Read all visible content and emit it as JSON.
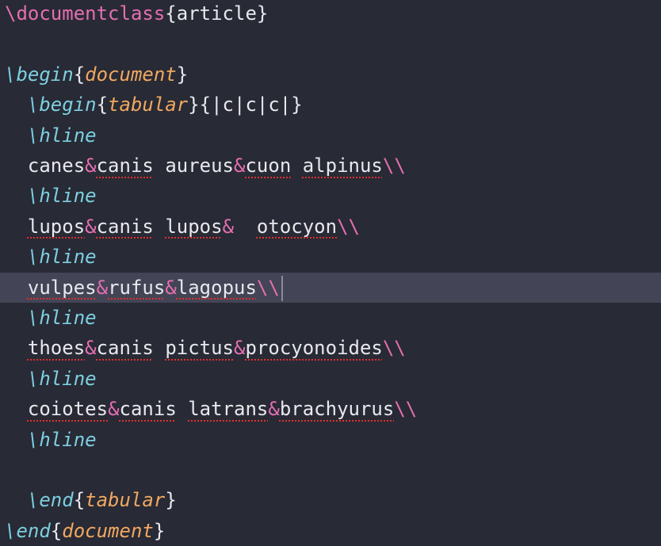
{
  "editor": {
    "lines": [
      {
        "tokens": [
          {
            "t": "\\documentclass",
            "c": "cmd"
          },
          {
            "t": "{",
            "c": "brace"
          },
          {
            "t": "article",
            "c": "txt"
          },
          {
            "t": "}",
            "c": "brace"
          }
        ]
      },
      {
        "tokens": []
      },
      {
        "tokens": [
          {
            "t": "\\",
            "c": "kw"
          },
          {
            "t": "begin",
            "c": "kw"
          },
          {
            "t": "{",
            "c": "brace"
          },
          {
            "t": "document",
            "c": "env"
          },
          {
            "t": "}",
            "c": "brace"
          }
        ]
      },
      {
        "tokens": [
          {
            "t": "  \\begin",
            "c": "kw"
          },
          {
            "t": "{",
            "c": "brace"
          },
          {
            "t": "tabular",
            "c": "env"
          },
          {
            "t": "}{|c|c|c|}",
            "c": "txt"
          }
        ]
      },
      {
        "tokens": [
          {
            "t": "  \\hline",
            "c": "kw"
          }
        ]
      },
      {
        "tokens": [
          {
            "t": "  ",
            "c": "txt"
          },
          {
            "t": "canes",
            "c": "txt"
          },
          {
            "t": "&",
            "c": "amp"
          },
          {
            "t": "canis",
            "c": "txt",
            "s": 1
          },
          {
            "t": " ",
            "c": "txt"
          },
          {
            "t": "aureus",
            "c": "txt"
          },
          {
            "t": "&",
            "c": "amp"
          },
          {
            "t": "cuon",
            "c": "txt",
            "s": 1
          },
          {
            "t": " ",
            "c": "txt"
          },
          {
            "t": "alpinus",
            "c": "txt",
            "s": 1
          },
          {
            "t": "\\\\",
            "c": "bs"
          }
        ]
      },
      {
        "tokens": [
          {
            "t": "  \\hline",
            "c": "kw"
          }
        ]
      },
      {
        "tokens": [
          {
            "t": "  ",
            "c": "txt"
          },
          {
            "t": "lupos",
            "c": "txt",
            "s": 1
          },
          {
            "t": "&",
            "c": "amp"
          },
          {
            "t": "canis",
            "c": "txt",
            "s": 1
          },
          {
            "t": " ",
            "c": "txt"
          },
          {
            "t": "lupos",
            "c": "txt",
            "s": 1
          },
          {
            "t": "&",
            "c": "amp"
          },
          {
            "t": "  ",
            "c": "txt"
          },
          {
            "t": "otocyon",
            "c": "txt",
            "s": 1
          },
          {
            "t": "\\\\",
            "c": "bs"
          }
        ]
      },
      {
        "tokens": [
          {
            "t": "  \\hline",
            "c": "kw"
          }
        ]
      },
      {
        "tokens": [
          {
            "t": "  ",
            "c": "txt"
          },
          {
            "t": "vulpes",
            "c": "txt",
            "s": 1
          },
          {
            "t": "&",
            "c": "amp"
          },
          {
            "t": "rufus",
            "c": "txt",
            "s": 1
          },
          {
            "t": "&",
            "c": "amp"
          },
          {
            "t": "lagopus",
            "c": "txt",
            "s": 1
          },
          {
            "t": "\\\\",
            "c": "bs"
          }
        ],
        "current": true
      },
      {
        "tokens": [
          {
            "t": "  \\hline",
            "c": "kw"
          }
        ]
      },
      {
        "tokens": [
          {
            "t": "  ",
            "c": "txt"
          },
          {
            "t": "thoes",
            "c": "txt",
            "s": 1
          },
          {
            "t": "&",
            "c": "amp"
          },
          {
            "t": "canis",
            "c": "txt",
            "s": 1
          },
          {
            "t": " ",
            "c": "txt"
          },
          {
            "t": "pictus",
            "c": "txt",
            "s": 1
          },
          {
            "t": "&",
            "c": "amp"
          },
          {
            "t": "procyonoides",
            "c": "txt",
            "s": 1
          },
          {
            "t": "\\\\",
            "c": "bs"
          }
        ]
      },
      {
        "tokens": [
          {
            "t": "  \\hline",
            "c": "kw"
          }
        ]
      },
      {
        "tokens": [
          {
            "t": "  ",
            "c": "txt"
          },
          {
            "t": "coiotes",
            "c": "txt",
            "s": 1
          },
          {
            "t": "&",
            "c": "amp"
          },
          {
            "t": "canis",
            "c": "txt",
            "s": 1
          },
          {
            "t": " ",
            "c": "txt"
          },
          {
            "t": "latrans",
            "c": "txt",
            "s": 1
          },
          {
            "t": "&",
            "c": "amp"
          },
          {
            "t": "brachyurus",
            "c": "txt",
            "s": 1
          },
          {
            "t": "\\\\",
            "c": "bs"
          }
        ]
      },
      {
        "tokens": [
          {
            "t": "  \\hline",
            "c": "kw"
          }
        ]
      },
      {
        "tokens": []
      },
      {
        "tokens": [
          {
            "t": "  \\end",
            "c": "kw"
          },
          {
            "t": "{",
            "c": "brace"
          },
          {
            "t": "tabular",
            "c": "env"
          },
          {
            "t": "}",
            "c": "brace"
          }
        ]
      },
      {
        "tokens": [
          {
            "t": "\\end",
            "c": "kw"
          },
          {
            "t": "{",
            "c": "brace"
          },
          {
            "t": "document",
            "c": "env"
          },
          {
            "t": "}",
            "c": "brace"
          }
        ]
      }
    ]
  }
}
